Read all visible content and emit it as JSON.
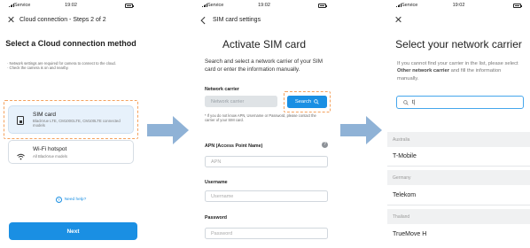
{
  "status_bar": {
    "carrier": "Service",
    "time": "19:02"
  },
  "screen1": {
    "nav_title": "Cloud connection - Steps 2 of 2",
    "title": "Select a Cloud connection method",
    "notes": [
      "· Network settings are required for camera to connect to the cloud.",
      "· Check the camera is on and nearby."
    ],
    "options": [
      {
        "title": "SIM card",
        "subtitle": "BlackVue LTE, CM100GLTE, CM100LTE connected models",
        "icon": "sim-card-icon",
        "selected": true
      },
      {
        "title": "Wi-Fi hotspot",
        "subtitle": "All BlackVue models",
        "icon": "wifi-icon",
        "selected": false
      }
    ],
    "help_label": "Need help?",
    "next_label": "Next"
  },
  "screen2": {
    "nav_title": "SIM card settings",
    "title": "Activate SIM card",
    "description": "Search and select a network carrier of your SIM card or enter the information manually.",
    "carrier_label": "Network carrier",
    "carrier_placeholder": "Network carrier",
    "search_label": "Search",
    "note": "* If you do not know APN, Username or Password, please contact the carrier of your SIM card.",
    "apn_label": "APN (Access Point Name)",
    "apn_placeholder": "APN",
    "username_label": "Username",
    "username_placeholder": "Username",
    "password_label": "Password",
    "password_placeholder": "Password"
  },
  "screen3": {
    "title": "Select your network carrier",
    "desc_before": "If you cannot find your carrier in the list, please select ",
    "desc_bold": "Other network carrier",
    "desc_after": " and fill the information manually.",
    "search_value": "t|",
    "groups": [
      {
        "country": "Australia",
        "carrier": "T-Mobile"
      },
      {
        "country": "Germany",
        "carrier": "Telekom"
      },
      {
        "country": "Thailand",
        "carrier": "TrueMove H"
      }
    ]
  },
  "colors": {
    "accent": "#1a8fe3",
    "highlight_dash": "#f4a15d",
    "arrow": "#8fb2d6"
  }
}
